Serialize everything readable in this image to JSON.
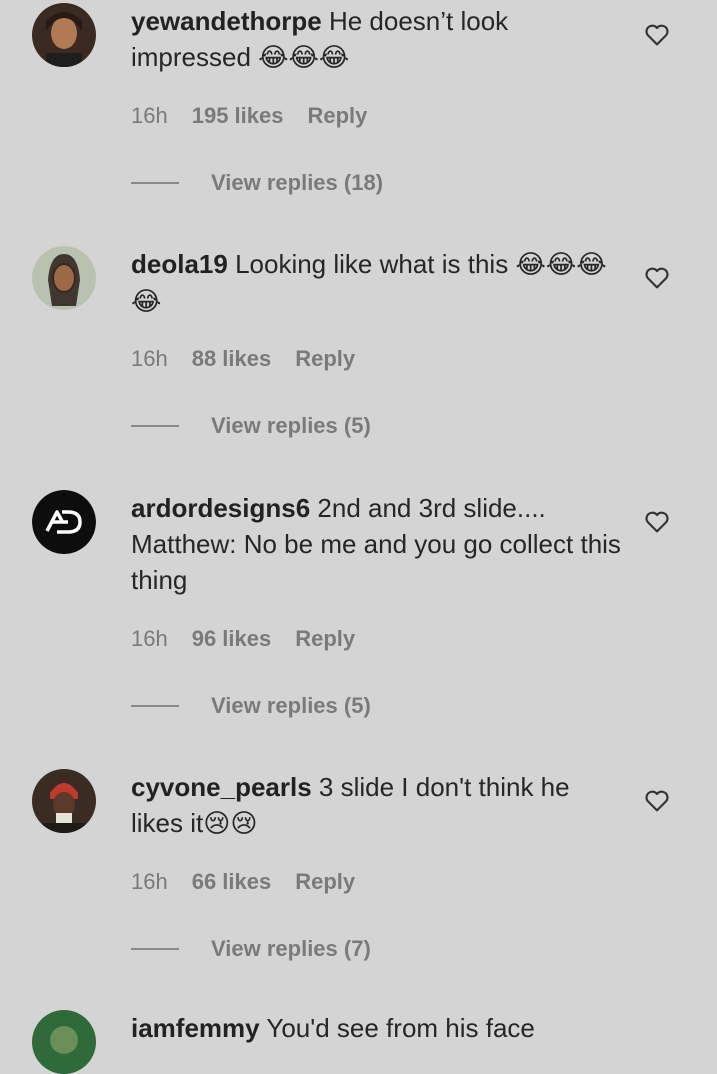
{
  "comments": [
    {
      "username": "yewandethorpe",
      "text": "He doesn’t look impressed",
      "emoji": "😂😂😂",
      "time": "16h",
      "likes": "195 likes",
      "reply": "Reply",
      "view_replies": "View replies (18)"
    },
    {
      "username": "deola19",
      "text": "Looking like what is this",
      "emoji": "😂😂😂😂",
      "time": "16h",
      "likes": "88 likes",
      "reply": "Reply",
      "view_replies": "View replies (5)"
    },
    {
      "username": "ardordesigns6",
      "text": "2nd and 3rd slide.... Matthew: No be me and you go collect this thing",
      "emoji": "",
      "time": "16h",
      "likes": "96 likes",
      "reply": "Reply",
      "view_replies": "View replies (5)"
    },
    {
      "username": "cyvone_pearls",
      "text": "3 slide I don't think he likes it",
      "emoji": "😢😢",
      "time": "16h",
      "likes": "66 likes",
      "reply": "Reply",
      "view_replies": "View replies (7)"
    }
  ],
  "next_comment": {
    "username": "iamfemmy",
    "text": "You'd see from his face"
  },
  "colors": {
    "background": "#d4d4d4",
    "text": "#262626",
    "meta": "#7a7a7a"
  }
}
